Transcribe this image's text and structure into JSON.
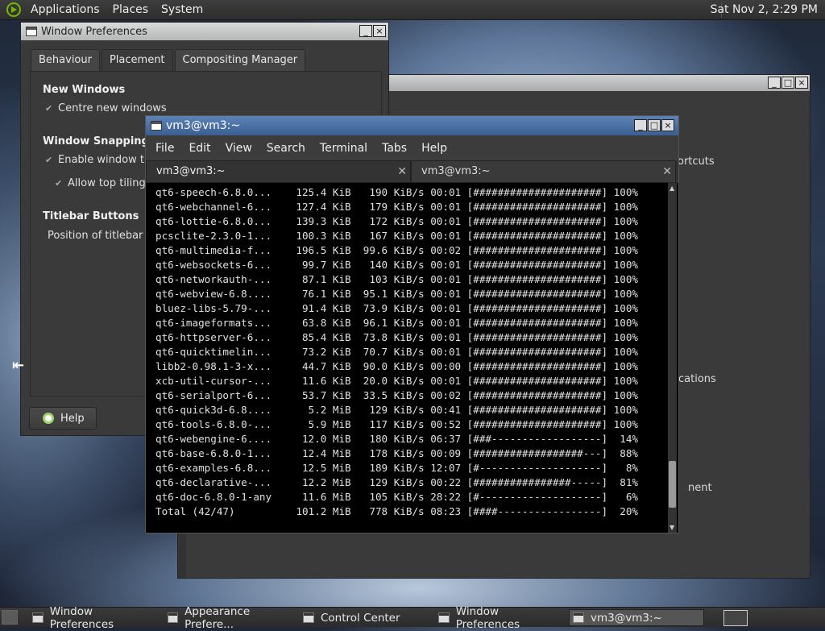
{
  "top_panel": {
    "menus": [
      "Applications",
      "Places",
      "System"
    ],
    "clock": "Sat Nov 2, 2:29 PM"
  },
  "back_window": {
    "frag1": "ortcuts",
    "frag2": "cations",
    "frag3": "nent",
    "controls": [
      "_",
      "□",
      "×"
    ]
  },
  "prefs": {
    "title": "Window Preferences",
    "tabs": [
      "Behaviour",
      "Placement",
      "Compositing Manager"
    ],
    "new_windows": "New Windows",
    "centre": "Centre new windows",
    "snapping": "Window Snapping",
    "enable_tiling": "Enable window tili",
    "allow_top": "Allow top tiling",
    "titlebar_buttons": "Titlebar Buttons",
    "position": "Position of titlebar b",
    "help": "Help",
    "controls": [
      "_",
      "×"
    ]
  },
  "terminal": {
    "title": "vm3@vm3:~",
    "menu": [
      "File",
      "Edit",
      "View",
      "Search",
      "Terminal",
      "Tabs",
      "Help"
    ],
    "tabs": [
      "vm3@vm3:~",
      "vm3@vm3:~"
    ],
    "lines": [
      "qt6-speech-6.8.0...    125.4 KiB   190 KiB/s 00:01 [#####################] 100%",
      "qt6-webchannel-6...    127.4 KiB   179 KiB/s 00:01 [#####################] 100%",
      "qt6-lottie-6.8.0...    139.3 KiB   172 KiB/s 00:01 [#####################] 100%",
      "pcsclite-2.3.0-1...    100.3 KiB   167 KiB/s 00:01 [#####################] 100%",
      "qt6-multimedia-f...    196.5 KiB  99.6 KiB/s 00:02 [#####################] 100%",
      "qt6-websockets-6...     99.7 KiB   140 KiB/s 00:01 [#####################] 100%",
      "qt6-networkauth-...     87.1 KiB   103 KiB/s 00:01 [#####################] 100%",
      "qt6-webview-6.8....     76.1 KiB  95.1 KiB/s 00:01 [#####################] 100%",
      "bluez-libs-5.79-...     91.4 KiB  73.9 KiB/s 00:01 [#####################] 100%",
      "qt6-imageformats...     63.8 KiB  96.1 KiB/s 00:01 [#####################] 100%",
      "qt6-httpserver-6...     85.4 KiB  73.8 KiB/s 00:01 [#####################] 100%",
      "qt6-quicktimelin...     73.2 KiB  70.7 KiB/s 00:01 [#####################] 100%",
      "libb2-0.98.1-3-x...     44.7 KiB  90.0 KiB/s 00:00 [#####################] 100%",
      "xcb-util-cursor-...     11.6 KiB  20.0 KiB/s 00:01 [#####################] 100%",
      "qt6-serialport-6...     53.7 KiB  33.5 KiB/s 00:02 [#####################] 100%",
      "qt6-quick3d-6.8....      5.2 MiB   129 KiB/s 00:41 [#####################] 100%",
      "qt6-tools-6.8.0-...      5.9 MiB   117 KiB/s 00:52 [#####################] 100%",
      "qt6-webengine-6....     12.0 MiB   180 KiB/s 06:37 [###------------------]  14%",
      "qt6-base-6.8.0-1...     12.4 MiB   178 KiB/s 00:09 [##################---]  88%",
      "qt6-examples-6.8...     12.5 MiB   189 KiB/s 12:07 [#--------------------]   8%",
      "qt6-declarative-...     12.2 MiB   129 KiB/s 00:22 [################-----]  81%",
      "qt6-doc-6.8.0-1-any     11.6 MiB   105 KiB/s 28:22 [#--------------------]   6%",
      "Total (42/47)          101.2 MiB   778 KiB/s 08:23 [####-----------------]  20%"
    ],
    "controls": [
      "_",
      "□",
      "×"
    ]
  },
  "taskbar": {
    "items": [
      "Window Preferences",
      "Appearance Prefere...",
      "Control Center",
      "Window Preferences",
      "vm3@vm3:~"
    ]
  }
}
